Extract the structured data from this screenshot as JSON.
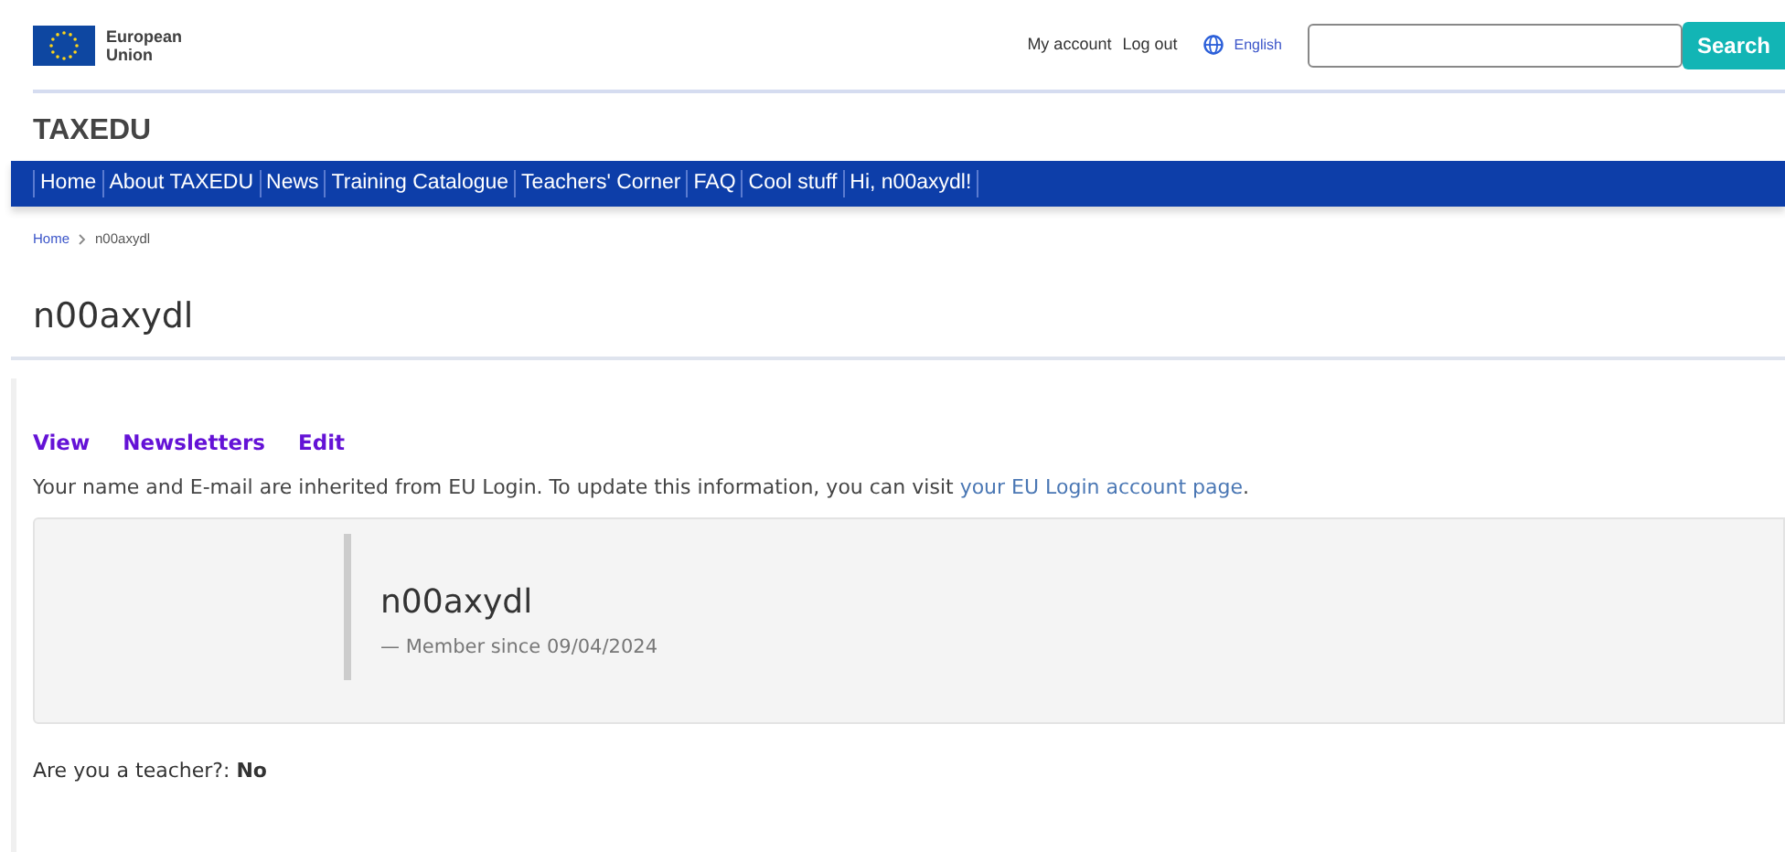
{
  "header": {
    "logo_text": [
      "European",
      "Union"
    ],
    "links": [
      "My account",
      "Log out"
    ],
    "language": "English",
    "search_button": "Search"
  },
  "site_name": "TAXEDU",
  "nav": [
    "Home",
    "About TAXEDU",
    "News",
    "Training Catalogue",
    "Teachers' Corner",
    "FAQ",
    "Cool stuff",
    "Hi, n00axydl!"
  ],
  "breadcrumb": [
    "Home",
    "n00axydl"
  ],
  "page_title": "n00axydl",
  "profile_tabs": [
    "View",
    "Newsletters",
    "Edit"
  ],
  "notice": {
    "text": "Your name and E-mail are inherited from EU Login. To update this information, you can visit ",
    "link": "your EU Login account page",
    "end": "."
  },
  "profile_card": {
    "name": "n00axydl",
    "member_since": "— Member since 09/04/2024"
  },
  "teacher_field": "Are you a teacher?: **No**"
}
